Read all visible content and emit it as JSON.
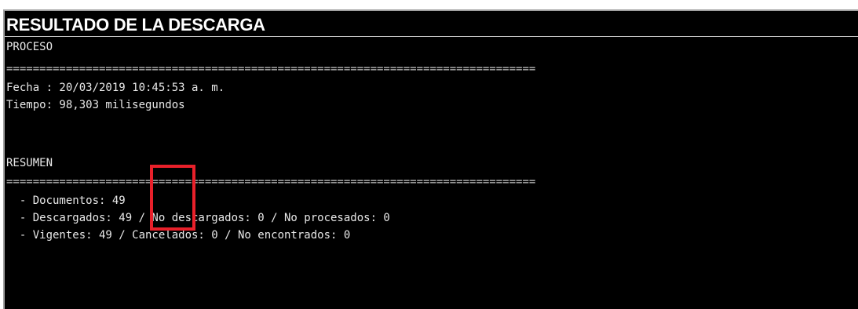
{
  "window": {
    "title": "RESULTADO DE LA DESCARGA"
  },
  "console": {
    "proceso_header": "PROCESO",
    "separator_1": "================================================================================",
    "fecha": "Fecha : 20/03/2019 10:45:53 a. m.",
    "tiempo": "Tiempo: 98,303 milisegundos",
    "resumen_header": "RESUMEN",
    "separator_2": "================================================================================",
    "documentos": "  - Documentos: 49",
    "descargados": "  - Descargados: 49 / No descargados: 0 / No procesados: 0",
    "vigentes": "  - Vigentes: 49 / Cancelados: 0 / No encontrados: 0"
  },
  "colors": {
    "background": "#000000",
    "text": "#e8e8e8",
    "highlight": "#e8202a"
  }
}
